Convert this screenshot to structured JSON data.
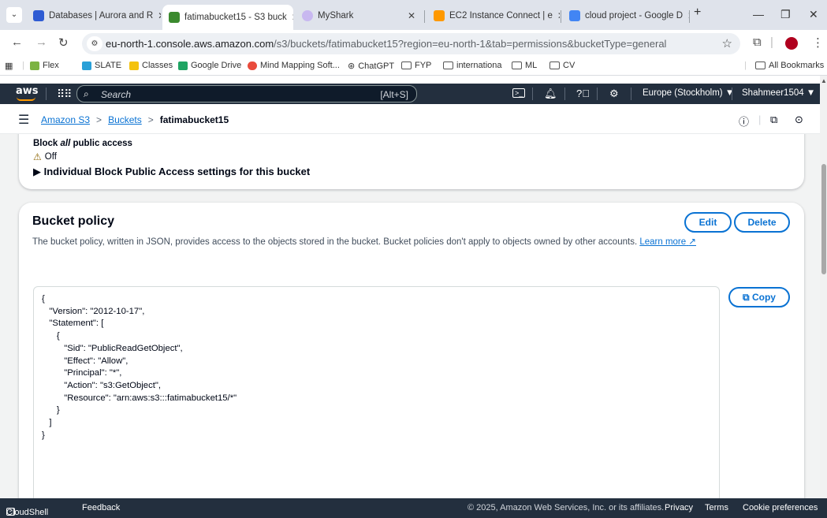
{
  "browser": {
    "tabs": [
      {
        "title": "Databases | Aurora and R",
        "active": false,
        "color": "#2e5bd3"
      },
      {
        "title": "fatimabucket15 - S3 buck",
        "active": true,
        "color": "#3b8a2e"
      },
      {
        "title": "MyShark",
        "active": false,
        "color": "#c8b8f0"
      },
      {
        "title": "EC2 Instance Connect | e",
        "active": false,
        "color": "#ff9900"
      },
      {
        "title": "cloud project - Google D",
        "active": false,
        "color": "#4285f4"
      }
    ],
    "new_tab": "+",
    "url_host": "eu-north-1.console.aws.amazon.com",
    "url_path": "/s3/buckets/fatimabucket15?region=eu-north-1&tab=permissions&bucketType=general",
    "bookmarks": [
      "Flex",
      "SLATE",
      "Classes",
      "Google Drive",
      "Mind Mapping Soft...",
      "ChatGPT",
      "FYP",
      "internationa",
      "ML",
      "CV"
    ],
    "all_bookmarks": "All Bookmarks"
  },
  "aws_nav": {
    "logo": "aws",
    "search_placeholder": "Search",
    "search_shortcut": "[Alt+S]",
    "region": "Europe (Stockholm) ▼",
    "account": "Shahmeer1504 ▼"
  },
  "breadcrumb": {
    "items": [
      "Amazon S3",
      "Buckets"
    ],
    "current": "fatimabucket15",
    "separator": ">"
  },
  "block_public_access": {
    "title_prefix": "Block ",
    "title_em": "all",
    "title_suffix": " public access",
    "status": "Off",
    "expand_label": "▶  Individual Block Public Access settings for this bucket"
  },
  "bucket_policy": {
    "title": "Bucket policy",
    "description": "The bucket policy, written in JSON, provides access to the objects stored in the bucket. Bucket policies don't apply to objects owned by other accounts.",
    "learn_more": "Learn more",
    "edit_label": "Edit",
    "delete_label": "Delete",
    "copy_label": "Copy",
    "policy_json": "{\n   \"Version\": \"2012-10-17\",\n   \"Statement\": [\n      {\n         \"Sid\": \"PublicReadGetObject\",\n         \"Effect\": \"Allow\",\n         \"Principal\": \"*\",\n         \"Action\": \"s3:GetObject\",\n         \"Resource\": \"arn:aws:s3:::fatimabucket15/*\"\n      }\n   ]\n}"
  },
  "footer": {
    "cloudshell": "CloudShell",
    "feedback": "Feedback",
    "copyright": "© 2025, Amazon Web Services, Inc. or its affiliates.",
    "privacy": "Privacy",
    "terms": "Terms",
    "cookie": "Cookie preferences"
  },
  "colors": {
    "aws_nav_bg": "#232f3e",
    "aws_orange": "#ff9900",
    "link_blue": "#0972d3",
    "warning": "#8d6605"
  }
}
